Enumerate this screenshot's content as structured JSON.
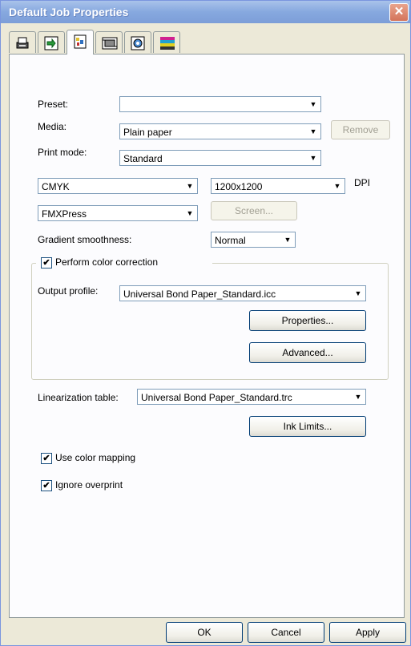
{
  "window": {
    "title": "Default Job Properties",
    "close_glyph": "✕"
  },
  "tabs": [
    {
      "icon": "printer-icon",
      "active": false
    },
    {
      "icon": "transfer-icon",
      "active": false
    },
    {
      "icon": "color-doc-icon",
      "active": true
    },
    {
      "icon": "film-icon",
      "active": false
    },
    {
      "icon": "target-icon",
      "active": false
    },
    {
      "icon": "color-bars-icon",
      "active": false
    }
  ],
  "preset": {
    "label": "Preset:",
    "value": ""
  },
  "media": {
    "label": "Media:",
    "value": "Plain paper",
    "remove_label": "Remove"
  },
  "print_mode": {
    "label": "Print mode:",
    "value": "Standard"
  },
  "color_space": {
    "value": "CMYK"
  },
  "resolution": {
    "value": "1200x1200",
    "unit": "DPI"
  },
  "screening": {
    "value": "FMXPress",
    "screen_label": "Screen..."
  },
  "gradient": {
    "label": "Gradient smoothness:",
    "value": "Normal"
  },
  "color_correction": {
    "label": "Perform color correction",
    "checked": true,
    "output_profile_label": "Output profile:",
    "output_profile_value": "Universal Bond Paper_Standard.icc",
    "properties_label": "Properties...",
    "advanced_label": "Advanced..."
  },
  "linearization": {
    "label": "Linearization table:",
    "value": "Universal Bond Paper_Standard.trc",
    "ink_limits_label": "Ink Limits..."
  },
  "options": {
    "color_mapping_label": "Use color mapping",
    "ignore_overprint_label": "Ignore overprint",
    "check_glyph": "✔"
  },
  "footer": {
    "ok_label": "OK",
    "cancel_label": "Cancel",
    "apply_label": "Apply"
  },
  "dropdown_arrow": "▼",
  "colors": {
    "titlebar": "#86a8df",
    "close": "#d4735a",
    "panel": "#fcfcfe",
    "face": "#ece9d8"
  }
}
